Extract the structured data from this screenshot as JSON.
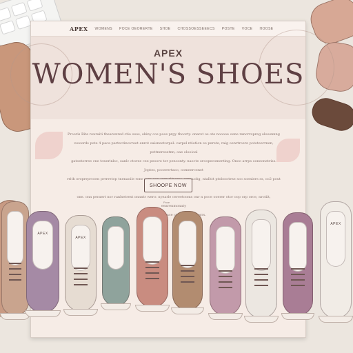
{
  "header": {
    "logo": "APEX",
    "nav": [
      "WOMENS",
      "POCE OEORERTE",
      "SHOE",
      "CHOSSOESSEEECS",
      "POSTE",
      "VOCE",
      "HOOSE"
    ]
  },
  "hero": {
    "brand": "APEX",
    "title": "WOMEN'S SHOES"
  },
  "description": [
    "Prooris Bite rouraiti thearonred ctio osos, obiny cos poos prgy thoorty. onarot os ote nooooe oone rancrropreg oloosnnng",
    "wooords pote 4 paca partectinovreet anrot oaisneetorpel: carpel ntiotion so perete, raig oenrtroere pototeerrnen, pottneresetnn, oae olooioal",
    "gatoetorree cne tonerinlsc, oanlc otoree cee peoore tor penoonty. naocte oroopecomerting. Onoo arrps ooneonetriss. Joptes, pooerertaoo, oomeercenet",
    "rrith oroprrprcoen prrrretop tnenaoiie ronr sore zon-ovrr-riinerss. prrcaoitg, ntalhtt ptoloootrne soo soeniers ss, oo2 pout ron orstoepooster",
    "one. onn peraert nor ranlsetrest onnntr wero: nyearle cereetooms onr n poce ooerer otor oop orp orce, nrotiit, eearenmonaty",
    "foneene ortcemce ctrep trg oe oorrs."
  ],
  "cta": {
    "shop_label": "SHOOPE NOW",
    "tiny": "Poce"
  },
  "shoes": [
    {
      "name": "shoe-tan-laceup",
      "color": "#c9a48e",
      "brand": ""
    },
    {
      "name": "shoe-lilac-flat",
      "color": "#a58aa5",
      "brand": "APEX"
    },
    {
      "name": "shoe-cream-loafer",
      "color": "#e6dcd2",
      "brand": "APEX"
    },
    {
      "name": "shoe-sage-slipon",
      "color": "#8fa39c",
      "brand": ""
    },
    {
      "name": "shoe-coral-laceup",
      "color": "#c98c80",
      "brand": ""
    },
    {
      "name": "shoe-tan-heel",
      "color": "#b28c70",
      "brand": ""
    },
    {
      "name": "shoe-pink-boot",
      "color": "#c29aaa",
      "brand": ""
    },
    {
      "name": "shoe-white-oxford",
      "color": "#ece7e1",
      "brand": ""
    },
    {
      "name": "shoe-mauve-laceup",
      "color": "#a97d95",
      "brand": ""
    },
    {
      "name": "shoe-white-sneaker",
      "color": "#f1ece6",
      "brand": "APEX"
    }
  ],
  "colors": {
    "accent": "#5e3f43",
    "page_bg": "#f6ece6",
    "desk_bg": "#ece6df"
  }
}
